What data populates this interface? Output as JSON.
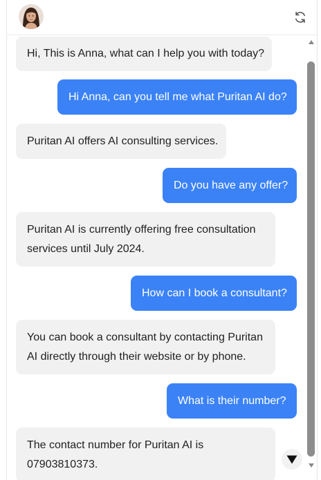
{
  "header": {
    "avatar_icon": "avatar-photo",
    "refresh_icon": "refresh-icon"
  },
  "messages": [
    {
      "role": "bot",
      "text": "Hi, This is Anna, what can I help you with today?"
    },
    {
      "role": "user",
      "text": "Hi Anna, can you tell me what Puritan AI do?"
    },
    {
      "role": "bot",
      "text": "Puritan AI offers AI consulting services."
    },
    {
      "role": "user",
      "text": "Do you have any offer?"
    },
    {
      "role": "bot",
      "lines": [
        "Puritan AI is currently offering free consultation",
        "services until July 2024."
      ]
    },
    {
      "role": "user",
      "text": "How can I book a consultant?"
    },
    {
      "role": "bot",
      "lines": [
        "You can book a consultant by contacting Puritan",
        "AI directly through their website or by phone."
      ]
    },
    {
      "role": "user",
      "text": "What is their number?"
    },
    {
      "role": "bot",
      "lines": [
        "The contact number for Puritan AI is",
        "07903810373."
      ]
    }
  ],
  "colors": {
    "user_bubble": "#3b82f6",
    "bot_bubble": "#f1f1f1"
  },
  "scroll_to_bottom_icon": "triangle-down-icon"
}
